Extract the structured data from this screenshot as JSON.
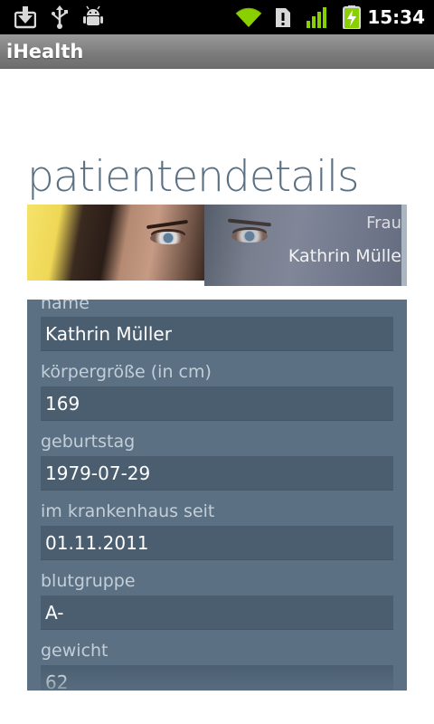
{
  "status_bar": {
    "time": "15:34",
    "icons": [
      "download-icon",
      "usb-icon",
      "android-debug-icon",
      "wifi-icon",
      "sim-alert-icon",
      "signal-icon",
      "battery-charging-icon"
    ],
    "colors": {
      "signal": "#8ad000",
      "battery": "#8ad000"
    }
  },
  "title_bar": {
    "title": "iHealth"
  },
  "page": {
    "heading": "patientendetails"
  },
  "header": {
    "label_small": "Frau",
    "patient_name": "Kathrin Mülle"
  },
  "fields": [
    {
      "label": "name",
      "value": "Kathrin Müller"
    },
    {
      "label": "körpergröße (in cm)",
      "value": "169"
    },
    {
      "label": "geburtstag",
      "value": "1979-07-29"
    },
    {
      "label": "im krankenhaus seit",
      "value": "01.11.2011"
    },
    {
      "label": "blutgruppe",
      "value": "A-"
    },
    {
      "label": "gewicht",
      "value": "62"
    }
  ],
  "colors": {
    "accent": "#5b7183",
    "field_bg": "#4a5e70",
    "label": "#c3ced8"
  }
}
